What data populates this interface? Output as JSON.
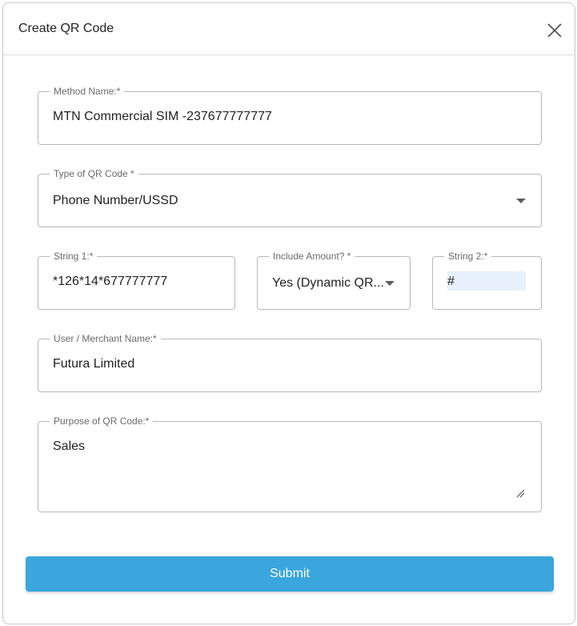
{
  "dialog": {
    "title": "Create QR Code",
    "close_icon": "close-icon"
  },
  "form": {
    "method_name": {
      "label": "Method Name:*",
      "value": "MTN Commercial SIM -237677777777"
    },
    "qr_type": {
      "label": "Type of QR Code *",
      "value": "Phone Number/USSD"
    },
    "string1": {
      "label": "String 1:*",
      "value": "*126*14*677777777"
    },
    "include_amount": {
      "label": "Include Amount? *",
      "value": "Yes (Dynamic QR..."
    },
    "string2": {
      "label": "String 2:*",
      "value": "#"
    },
    "merchant_name": {
      "label": "User / Merchant Name:*",
      "value": "Futura Limited"
    },
    "purpose": {
      "label": "Purpose of QR Code:*",
      "value": "Sales"
    }
  },
  "submit_label": "Submit",
  "colors": {
    "accent": "#3aa6dd",
    "autofill_highlight": "#e8f0fe"
  }
}
